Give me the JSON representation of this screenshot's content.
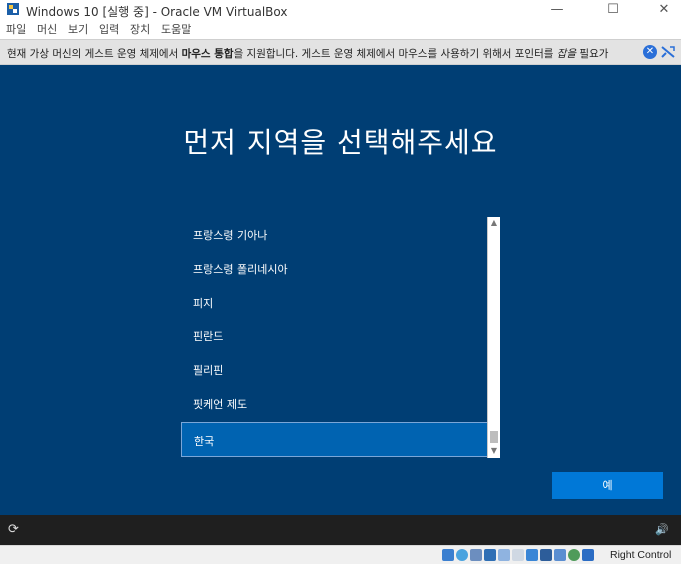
{
  "window": {
    "title": "Windows 10 [실행 중] - Oracle VM VirtualBox",
    "minimize": "—",
    "maximize": "☐",
    "close": "✕"
  },
  "menu": {
    "items": [
      "파일",
      "머신",
      "보기",
      "입력",
      "장치",
      "도움말"
    ]
  },
  "notice": {
    "text_prefix": "현재 가상 머신의 게스트 운영 체제에서 ",
    "text_bold": "마우스 통합",
    "text_suffix": "을 지원합니다. 게스트 운영 체제에서 마우스를 사용하기 위해서 포인터를 ",
    "text_italic": "잡을",
    "text_end": " 필요가",
    "close_glyph": "✕"
  },
  "setup": {
    "heading": "먼저 지역을 선택해주세요",
    "regions": [
      "프랑스령 기아나",
      "프랑스령 폴리네시아",
      "피지",
      "핀란드",
      "필리핀",
      "핏케언 제도"
    ],
    "selected_region": "한국",
    "yes_button": "예",
    "scroll_up": "▲",
    "scroll_down": "▼"
  },
  "taskbar": {
    "ease_icon": "⟳",
    "volume_icon": "🔊"
  },
  "statusbar": {
    "host_key": "Right Control"
  },
  "colors": {
    "guest_bg": "#003e74",
    "selection": "#0063b1",
    "accent_button": "#0078d7"
  }
}
